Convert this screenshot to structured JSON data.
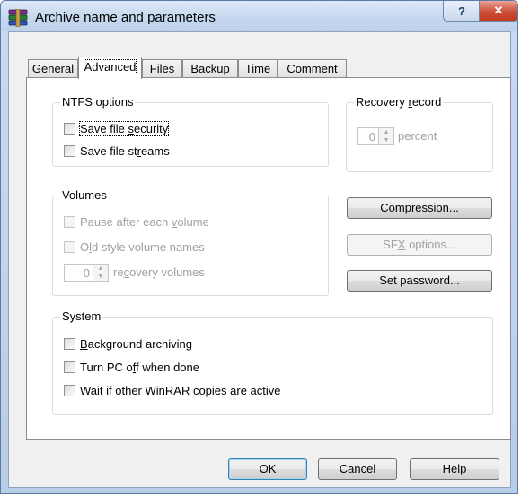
{
  "window": {
    "title": "Archive name and parameters",
    "help_glyph": "?",
    "close_glyph": "✕"
  },
  "tabs": [
    {
      "label": "General"
    },
    {
      "label": "Advanced",
      "active": true
    },
    {
      "label": "Files"
    },
    {
      "label": "Backup"
    },
    {
      "label": "Time"
    },
    {
      "label": "Comment"
    }
  ],
  "ntfs": {
    "title": "NTFS options",
    "save_security": {
      "pre": "Save file ",
      "key": "s",
      "post": "ecurity",
      "checked": false
    },
    "save_streams": {
      "pre": "Save file st",
      "key": "r",
      "post": "eams",
      "checked": false
    }
  },
  "recovery": {
    "title_pre": "Recovery ",
    "title_key": "r",
    "title_post": "ecord",
    "value": "0",
    "unit": "percent"
  },
  "volumes": {
    "title": "Volumes",
    "pause": {
      "pre": "Pause after each ",
      "key": "v",
      "post": "olume",
      "checked": false
    },
    "old_style": {
      "pre": "O",
      "key": "l",
      "post": "d style volume names",
      "checked": false
    },
    "recovery_value": "0",
    "recovery_pre": "re",
    "recovery_key": "c",
    "recovery_post": "overy volumes"
  },
  "buttons": {
    "compression": "Compression...",
    "sfx_pre": "SF",
    "sfx_key": "X",
    "sfx_post": " options...",
    "set_password": "Set password..."
  },
  "system": {
    "title": "System",
    "background": {
      "pre": "",
      "key": "B",
      "post": "ackground archiving",
      "checked": false
    },
    "turn_off": {
      "pre": "Turn PC o",
      "key": "f",
      "post": "f when done",
      "checked": false
    },
    "wait": {
      "pre": "",
      "key": "W",
      "post": "ait if other WinRAR copies are active",
      "checked": false
    }
  },
  "footer": {
    "ok": "OK",
    "cancel": "Cancel",
    "help": "Help"
  },
  "colors": {
    "title_bar": "#c4d7ee",
    "close_button": "#cd4e36",
    "disabled_text": "#a0a0a0"
  }
}
